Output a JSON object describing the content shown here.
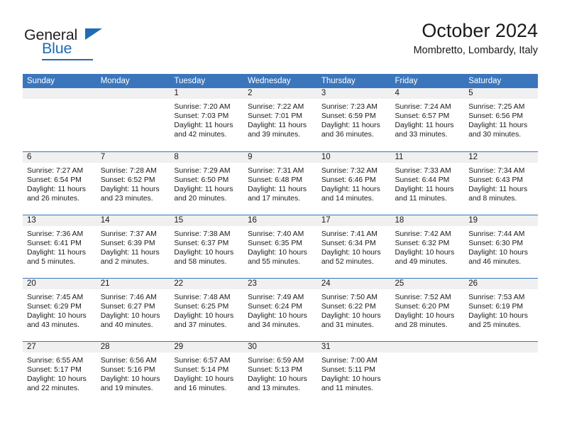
{
  "brand": {
    "word1": "General",
    "word2": "Blue",
    "triangle_color": "#1f6cb4",
    "text_color": "#231f20"
  },
  "header": {
    "title": "October 2024",
    "location": "Mombretto, Lombardy, Italy"
  },
  "theme": {
    "header_blue": "#3b76bd",
    "daynum_band": "#f0f0f0",
    "text": "#1a1a1a"
  },
  "calendar": {
    "weekday_headers": [
      "Sunday",
      "Monday",
      "Tuesday",
      "Wednesday",
      "Thursday",
      "Friday",
      "Saturday"
    ],
    "weeks": [
      [
        {
          "day": "",
          "lines": []
        },
        {
          "day": "",
          "lines": []
        },
        {
          "day": "1",
          "lines": [
            "Sunrise: 7:20 AM",
            "Sunset: 7:03 PM",
            "Daylight: 11 hours",
            "and 42 minutes."
          ]
        },
        {
          "day": "2",
          "lines": [
            "Sunrise: 7:22 AM",
            "Sunset: 7:01 PM",
            "Daylight: 11 hours",
            "and 39 minutes."
          ]
        },
        {
          "day": "3",
          "lines": [
            "Sunrise: 7:23 AM",
            "Sunset: 6:59 PM",
            "Daylight: 11 hours",
            "and 36 minutes."
          ]
        },
        {
          "day": "4",
          "lines": [
            "Sunrise: 7:24 AM",
            "Sunset: 6:57 PM",
            "Daylight: 11 hours",
            "and 33 minutes."
          ]
        },
        {
          "day": "5",
          "lines": [
            "Sunrise: 7:25 AM",
            "Sunset: 6:56 PM",
            "Daylight: 11 hours",
            "and 30 minutes."
          ]
        }
      ],
      [
        {
          "day": "6",
          "lines": [
            "Sunrise: 7:27 AM",
            "Sunset: 6:54 PM",
            "Daylight: 11 hours",
            "and 26 minutes."
          ]
        },
        {
          "day": "7",
          "lines": [
            "Sunrise: 7:28 AM",
            "Sunset: 6:52 PM",
            "Daylight: 11 hours",
            "and 23 minutes."
          ]
        },
        {
          "day": "8",
          "lines": [
            "Sunrise: 7:29 AM",
            "Sunset: 6:50 PM",
            "Daylight: 11 hours",
            "and 20 minutes."
          ]
        },
        {
          "day": "9",
          "lines": [
            "Sunrise: 7:31 AM",
            "Sunset: 6:48 PM",
            "Daylight: 11 hours",
            "and 17 minutes."
          ]
        },
        {
          "day": "10",
          "lines": [
            "Sunrise: 7:32 AM",
            "Sunset: 6:46 PM",
            "Daylight: 11 hours",
            "and 14 minutes."
          ]
        },
        {
          "day": "11",
          "lines": [
            "Sunrise: 7:33 AM",
            "Sunset: 6:44 PM",
            "Daylight: 11 hours",
            "and 11 minutes."
          ]
        },
        {
          "day": "12",
          "lines": [
            "Sunrise: 7:34 AM",
            "Sunset: 6:43 PM",
            "Daylight: 11 hours",
            "and 8 minutes."
          ]
        }
      ],
      [
        {
          "day": "13",
          "lines": [
            "Sunrise: 7:36 AM",
            "Sunset: 6:41 PM",
            "Daylight: 11 hours",
            "and 5 minutes."
          ]
        },
        {
          "day": "14",
          "lines": [
            "Sunrise: 7:37 AM",
            "Sunset: 6:39 PM",
            "Daylight: 11 hours",
            "and 2 minutes."
          ]
        },
        {
          "day": "15",
          "lines": [
            "Sunrise: 7:38 AM",
            "Sunset: 6:37 PM",
            "Daylight: 10 hours",
            "and 58 minutes."
          ]
        },
        {
          "day": "16",
          "lines": [
            "Sunrise: 7:40 AM",
            "Sunset: 6:35 PM",
            "Daylight: 10 hours",
            "and 55 minutes."
          ]
        },
        {
          "day": "17",
          "lines": [
            "Sunrise: 7:41 AM",
            "Sunset: 6:34 PM",
            "Daylight: 10 hours",
            "and 52 minutes."
          ]
        },
        {
          "day": "18",
          "lines": [
            "Sunrise: 7:42 AM",
            "Sunset: 6:32 PM",
            "Daylight: 10 hours",
            "and 49 minutes."
          ]
        },
        {
          "day": "19",
          "lines": [
            "Sunrise: 7:44 AM",
            "Sunset: 6:30 PM",
            "Daylight: 10 hours",
            "and 46 minutes."
          ]
        }
      ],
      [
        {
          "day": "20",
          "lines": [
            "Sunrise: 7:45 AM",
            "Sunset: 6:29 PM",
            "Daylight: 10 hours",
            "and 43 minutes."
          ]
        },
        {
          "day": "21",
          "lines": [
            "Sunrise: 7:46 AM",
            "Sunset: 6:27 PM",
            "Daylight: 10 hours",
            "and 40 minutes."
          ]
        },
        {
          "day": "22",
          "lines": [
            "Sunrise: 7:48 AM",
            "Sunset: 6:25 PM",
            "Daylight: 10 hours",
            "and 37 minutes."
          ]
        },
        {
          "day": "23",
          "lines": [
            "Sunrise: 7:49 AM",
            "Sunset: 6:24 PM",
            "Daylight: 10 hours",
            "and 34 minutes."
          ]
        },
        {
          "day": "24",
          "lines": [
            "Sunrise: 7:50 AM",
            "Sunset: 6:22 PM",
            "Daylight: 10 hours",
            "and 31 minutes."
          ]
        },
        {
          "day": "25",
          "lines": [
            "Sunrise: 7:52 AM",
            "Sunset: 6:20 PM",
            "Daylight: 10 hours",
            "and 28 minutes."
          ]
        },
        {
          "day": "26",
          "lines": [
            "Sunrise: 7:53 AM",
            "Sunset: 6:19 PM",
            "Daylight: 10 hours",
            "and 25 minutes."
          ]
        }
      ],
      [
        {
          "day": "27",
          "lines": [
            "Sunrise: 6:55 AM",
            "Sunset: 5:17 PM",
            "Daylight: 10 hours",
            "and 22 minutes."
          ]
        },
        {
          "day": "28",
          "lines": [
            "Sunrise: 6:56 AM",
            "Sunset: 5:16 PM",
            "Daylight: 10 hours",
            "and 19 minutes."
          ]
        },
        {
          "day": "29",
          "lines": [
            "Sunrise: 6:57 AM",
            "Sunset: 5:14 PM",
            "Daylight: 10 hours",
            "and 16 minutes."
          ]
        },
        {
          "day": "30",
          "lines": [
            "Sunrise: 6:59 AM",
            "Sunset: 5:13 PM",
            "Daylight: 10 hours",
            "and 13 minutes."
          ]
        },
        {
          "day": "31",
          "lines": [
            "Sunrise: 7:00 AM",
            "Sunset: 5:11 PM",
            "Daylight: 10 hours",
            "and 11 minutes."
          ]
        },
        {
          "day": "",
          "lines": []
        },
        {
          "day": "",
          "lines": []
        }
      ]
    ]
  }
}
